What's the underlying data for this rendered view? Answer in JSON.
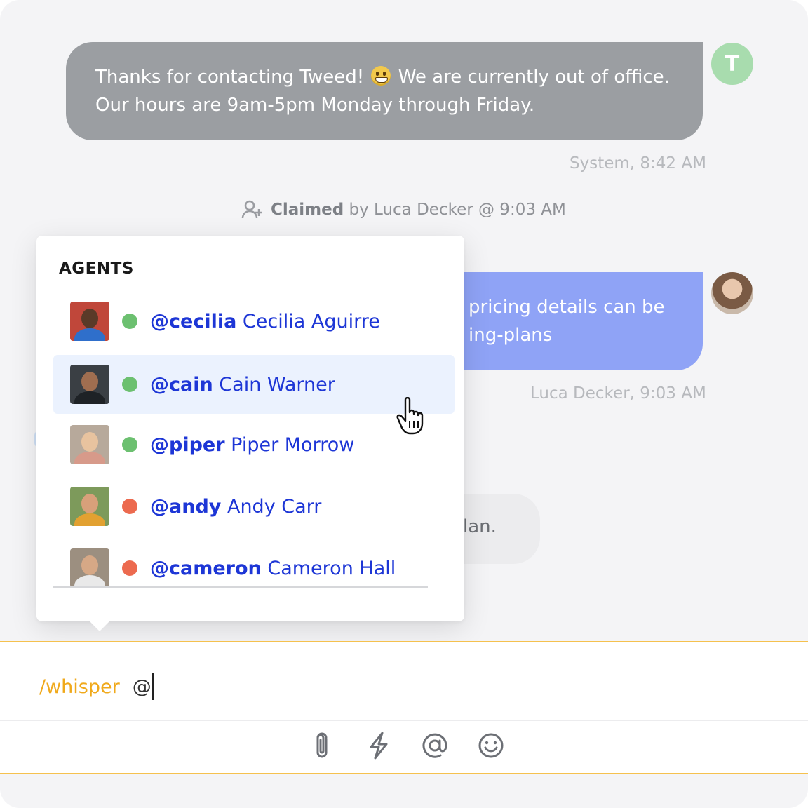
{
  "conversation": {
    "system_message": {
      "line1_a": "Thanks for contacting Tweed!",
      "line1_b": "We are currently out of office.",
      "line2": "Our hours are 9am-5pm Monday through Friday.",
      "emoji": "grinning-face-emoji",
      "meta": "System, 8:42 AM",
      "avatar_initial": "T"
    },
    "claimed": {
      "bold": "Claimed",
      "rest": "by Luca  Decker @ 9:03 AM"
    },
    "agent_message": {
      "line1": "pricing details can be",
      "line2": "ing-plans",
      "meta": "Luca Decker, 9:03 AM"
    },
    "customer_message": {
      "text": "lan."
    }
  },
  "mention_popup": {
    "title": "AGENTS",
    "agents": [
      {
        "handle": "@cecilia",
        "name": "Cecilia Aguirre",
        "status": "online"
      },
      {
        "handle": "@cain",
        "name": "Cain Warner",
        "status": "online"
      },
      {
        "handle": "@piper",
        "name": "Piper Morrow",
        "status": "online"
      },
      {
        "handle": "@andy",
        "name": "Andy Carr",
        "status": "away"
      },
      {
        "handle": "@cameron",
        "name": "Cameron Hall",
        "status": "away"
      }
    ]
  },
  "composer": {
    "command": "/whisper",
    "input_text": "@"
  },
  "toolbar": {
    "icons": [
      "paperclip-icon",
      "lightning-icon",
      "at-sign-icon",
      "smiley-icon"
    ]
  },
  "colors": {
    "online": "#6cc070",
    "away": "#ec6a4f",
    "mention_blue": "#1d36d6",
    "accent_yellow": "#f5c14e",
    "agent_bubble": "#8fa3f6",
    "system_bubble": "#9b9ea2"
  }
}
